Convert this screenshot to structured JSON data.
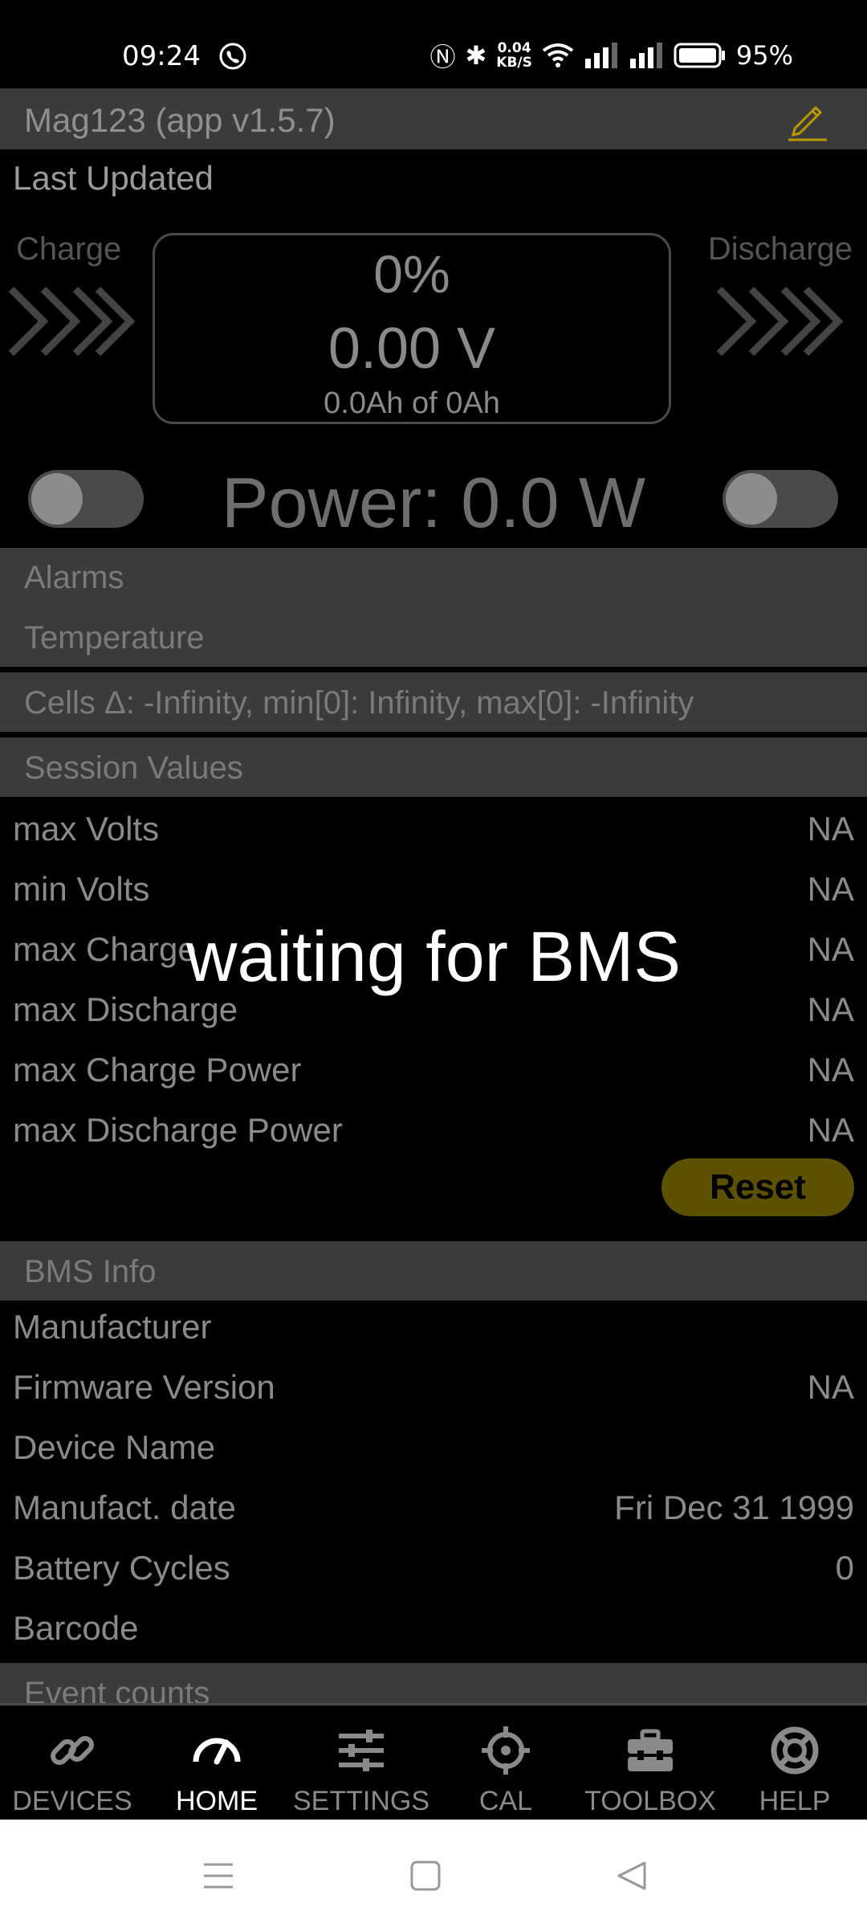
{
  "status_bar": {
    "time": "09:24",
    "net_speed": "0.04",
    "net_unit": "KB/S",
    "battery": "95%"
  },
  "app": {
    "title": "Mag123 (app v1.5.7)"
  },
  "last_updated_label": "Last Updated",
  "charge_label": "Charge",
  "discharge_label": "Discharge",
  "gauge": {
    "percent": "0%",
    "volts": "0.00 V",
    "capacity": "0.0Ah of 0Ah"
  },
  "power": "Power: 0.0 W",
  "sections": {
    "alarms": "Alarms",
    "temperature": "Temperature",
    "cells": "Cells Δ: -Infinity, min[0]: Infinity, max[0]: -Infinity",
    "session_values": "Session Values",
    "bms_info": "BMS Info",
    "event_counts": "Event counts"
  },
  "session_rows": [
    {
      "label": "max Volts",
      "value": "NA"
    },
    {
      "label": "min Volts",
      "value": "NA"
    },
    {
      "label": "max Charge",
      "value": "NA"
    },
    {
      "label": "max Discharge",
      "value": "NA"
    },
    {
      "label": "max Charge Power",
      "value": "NA"
    },
    {
      "label": "max Discharge Power",
      "value": "NA"
    }
  ],
  "reset_label": "Reset",
  "bms_rows": [
    {
      "label": "Manufacturer",
      "value": ""
    },
    {
      "label": "Firmware Version",
      "value": "NA"
    },
    {
      "label": "Device Name",
      "value": ""
    },
    {
      "label": "Manufact. date",
      "value": "Fri Dec 31 1999"
    },
    {
      "label": "Battery Cycles",
      "value": "0"
    },
    {
      "label": "Barcode",
      "value": ""
    }
  ],
  "overlay_message": "waiting for BMS",
  "nav": [
    {
      "label": "DEVICES",
      "icon": "link-icon"
    },
    {
      "label": "HOME",
      "icon": "speedometer-icon"
    },
    {
      "label": "SETTINGS",
      "icon": "sliders-icon"
    },
    {
      "label": "CAL",
      "icon": "crosshair-icon"
    },
    {
      "label": "TOOLBOX",
      "icon": "toolbox-icon"
    },
    {
      "label": "HELP",
      "icon": "lifebuoy-icon"
    }
  ],
  "accent_color": "#b89a00"
}
